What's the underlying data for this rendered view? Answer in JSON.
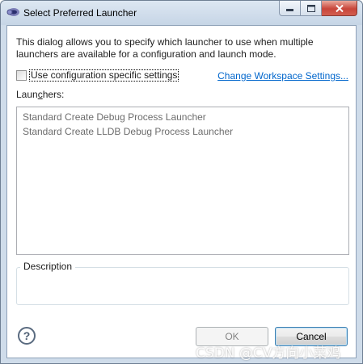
{
  "window": {
    "title": "Select Preferred Launcher",
    "app_icon": "eclipse-launcher-icon",
    "controls": [
      "minimize-icon",
      "maximize-icon",
      "close-icon"
    ]
  },
  "intro_text": "This dialog allows you to specify which launcher to use when multiple launchers are available for a configuration and launch mode.",
  "config_checkbox": {
    "label": "Use configuration specific settings",
    "checked": false
  },
  "workspace_link": "Change Workspace Settings...",
  "launchers": {
    "label_pre": "Laun",
    "label_mnemonic": "c",
    "label_post": "hers:",
    "items": [
      {
        "label": "Standard Create Debug Process Launcher"
      },
      {
        "label": "Standard Create LLDB Debug Process Launcher"
      }
    ]
  },
  "description": {
    "title": "Description",
    "text": ""
  },
  "help_icon": "?",
  "buttons": {
    "ok": "OK",
    "cancel": "Cancel"
  },
  "watermark": "CSDN @CV方向小菜鸡"
}
